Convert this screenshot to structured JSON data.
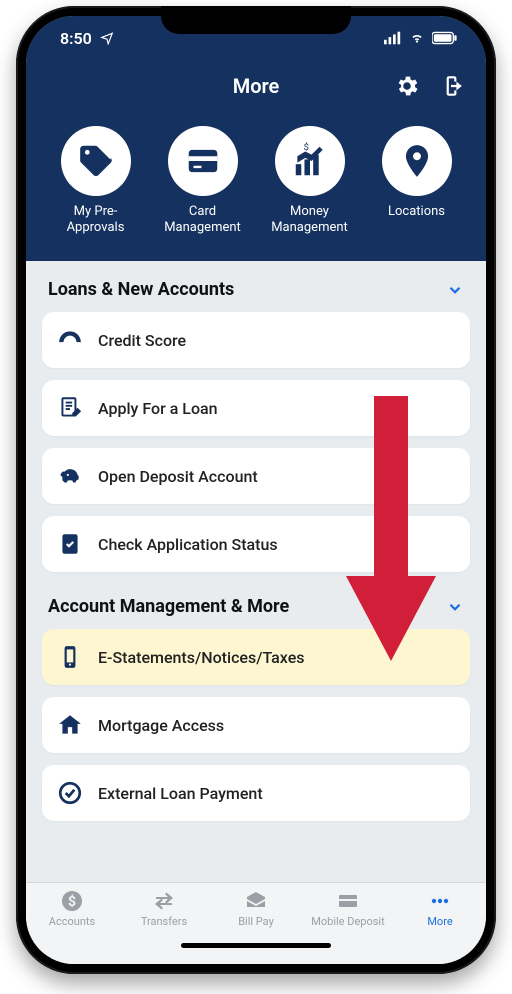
{
  "status": {
    "time": "8:50"
  },
  "header": {
    "title": "More",
    "quick": [
      {
        "label": "My Pre-Approvals"
      },
      {
        "label": "Card Management"
      },
      {
        "label": "Money Management"
      },
      {
        "label": "Locations"
      }
    ]
  },
  "sections": [
    {
      "title": "Loans & New Accounts",
      "items": [
        {
          "label": "Credit Score"
        },
        {
          "label": "Apply For a Loan"
        },
        {
          "label": "Open Deposit Account"
        },
        {
          "label": "Check Application Status"
        }
      ]
    },
    {
      "title": "Account Management & More",
      "items": [
        {
          "label": "E-Statements/Notices/Taxes",
          "highlight": true
        },
        {
          "label": "Mortgage Access"
        },
        {
          "label": "External Loan Payment"
        }
      ]
    }
  ],
  "tabs": [
    {
      "label": "Accounts"
    },
    {
      "label": "Transfers"
    },
    {
      "label": "Bill Pay"
    },
    {
      "label": "Mobile Deposit"
    },
    {
      "label": "More",
      "active": true
    }
  ]
}
